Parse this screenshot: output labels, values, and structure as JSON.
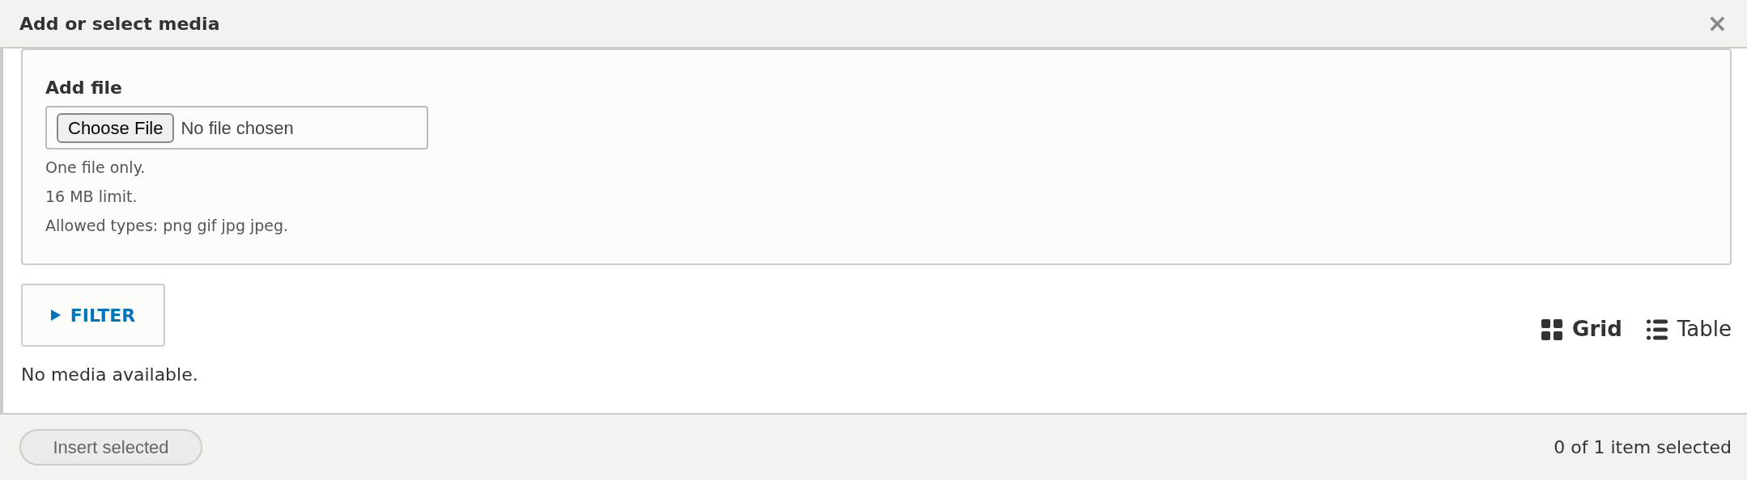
{
  "dialog": {
    "title": "Add or select media",
    "close": "×"
  },
  "upload": {
    "label": "Add file",
    "button": "Choose File",
    "status": "No file chosen",
    "hints": [
      "One file only.",
      "16 MB limit.",
      "Allowed types: png gif jpg jpeg."
    ]
  },
  "filter": {
    "label": "FILTER",
    "expanded": false
  },
  "views": [
    {
      "label": "Grid",
      "kind": "grid",
      "selected": true
    },
    {
      "label": "Table",
      "kind": "table",
      "selected": false
    }
  ],
  "message": "No media available.",
  "footer": {
    "button": {
      "label": "Insert selected",
      "disabled": true
    },
    "status": "0 of 1 item selected"
  }
}
